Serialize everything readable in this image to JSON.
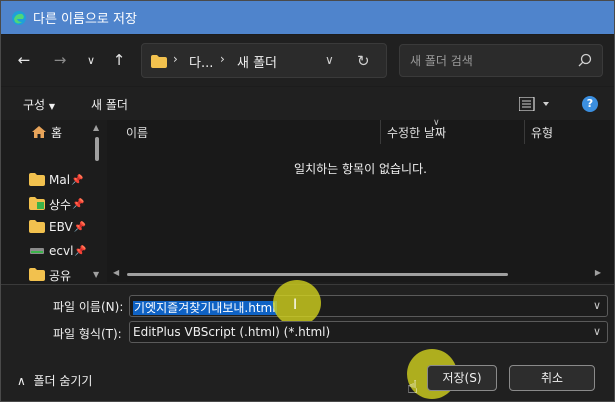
{
  "window": {
    "title": "다른 이름으로 저장"
  },
  "nav": {
    "breadcrumb": [
      "다...",
      "새 폴더"
    ],
    "search_placeholder": "새 폴더 검색"
  },
  "commandbar": {
    "organize": "구성",
    "new_folder": "새 폴더"
  },
  "sidebar": {
    "home": "홈",
    "items": [
      {
        "label": "Mal",
        "icon": "folder-icon"
      },
      {
        "label": "상수",
        "icon": "folder-green-icon"
      },
      {
        "label": "EBV",
        "icon": "folder-icon"
      },
      {
        "label": "ecvl",
        "icon": "drive-icon"
      },
      {
        "label": "공유",
        "icon": "folder-icon"
      }
    ]
  },
  "filelist": {
    "columns": [
      "이름",
      "수정한 날짜",
      "유형"
    ],
    "empty_message": "일치하는 항목이 없습니다."
  },
  "form": {
    "filename_label": "파일 이름(N):",
    "filename_value": "기엣지즐겨찾기내보내.html",
    "filetype_label": "파일 형식(T):",
    "filetype_value": "EditPlus VBScript (.html) (*.html)"
  },
  "footer": {
    "hide_folders": "폴더 숨기기",
    "save": "저장(S)",
    "cancel": "취소"
  },
  "colors": {
    "titlebar": "#4f84cc",
    "selection": "#0f62c4",
    "highlight": "#d6d61e"
  }
}
